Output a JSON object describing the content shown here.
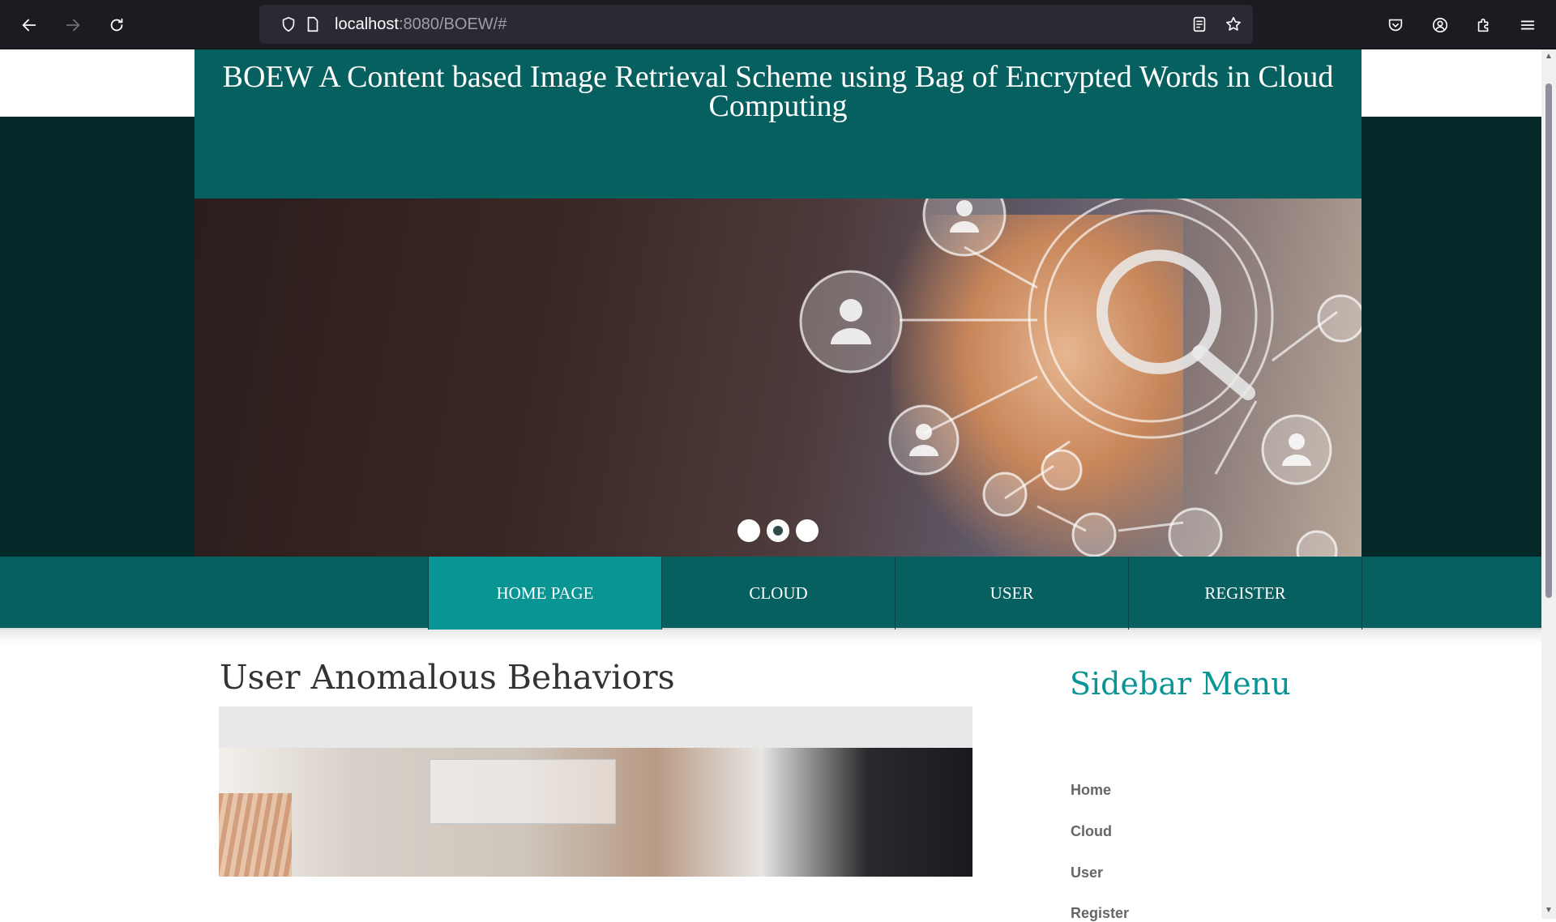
{
  "browser": {
    "url_host": "localhost",
    "url_path": ":8080/BOEW/#"
  },
  "site": {
    "title": "BOEW A Content based Image Retrieval Scheme using Bag of Encrypted Words in Cloud Computing"
  },
  "slider": {
    "slide_count": 3,
    "active_index": 1
  },
  "menu": {
    "items": [
      {
        "label": "HOME PAGE",
        "active": true
      },
      {
        "label": "CLOUD",
        "active": false
      },
      {
        "label": "USER",
        "active": false
      },
      {
        "label": "REGISTER",
        "active": false
      }
    ]
  },
  "main": {
    "title": "User Anomalous Behaviors"
  },
  "sidebar": {
    "title": "Sidebar Menu",
    "links": [
      "Home",
      "Cloud",
      "User",
      "Register"
    ]
  },
  "colors": {
    "header_teal": "#066060",
    "active_menu": "#0a9595",
    "dark_band": "#052828"
  }
}
